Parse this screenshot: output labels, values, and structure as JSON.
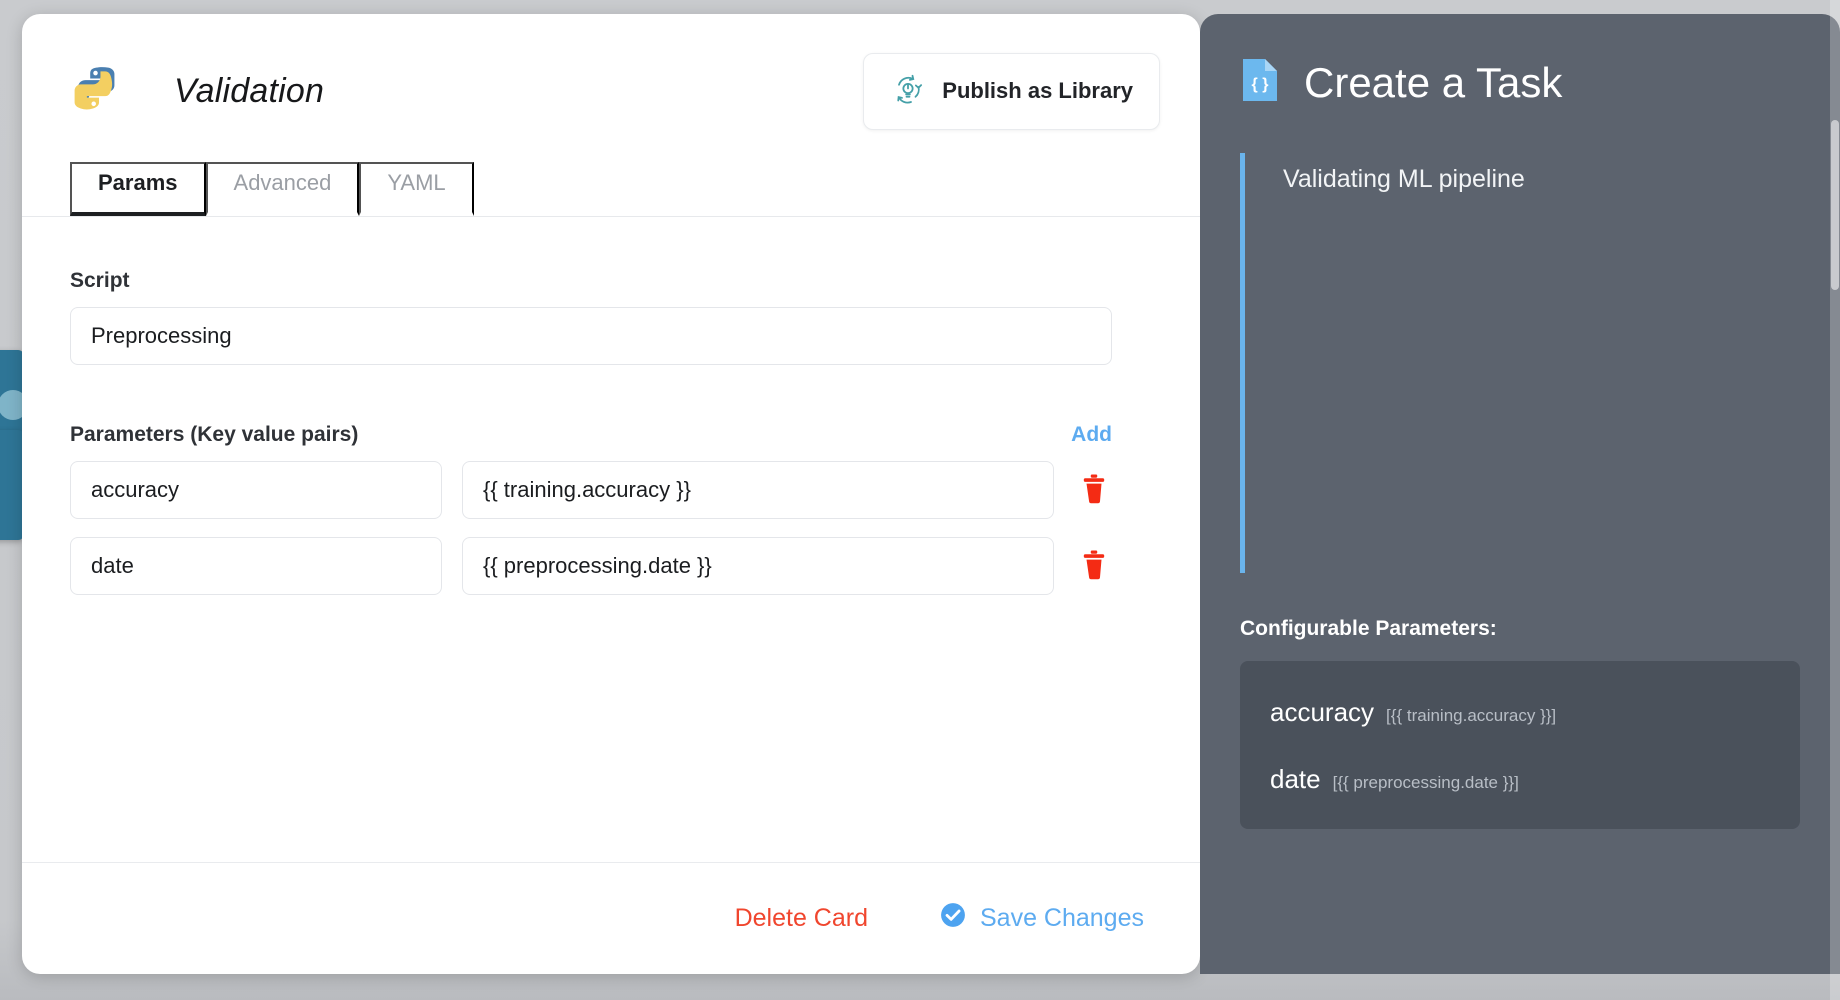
{
  "card": {
    "icon": "python-logo-icon",
    "title": "Validation",
    "publish": {
      "label": "Publish as Library",
      "icon": "recycle-lightbulb-icon"
    },
    "tabs": [
      {
        "label": "Params",
        "active": true
      },
      {
        "label": "Advanced",
        "active": false
      },
      {
        "label": "YAML",
        "active": false
      }
    ],
    "script": {
      "label": "Script",
      "value": "Preprocessing",
      "placeholder": "Script"
    },
    "parameters": {
      "label": "Parameters (Key value pairs)",
      "add_label": "Add",
      "key_placeholder": "Key",
      "value_placeholder": "Value",
      "delete_icon": "trash-icon",
      "rows": [
        {
          "key": "accuracy",
          "value": "{{ training.accuracy }}"
        },
        {
          "key": "date",
          "value": "{{ preprocessing.date }}"
        }
      ]
    },
    "footer": {
      "delete_label": "Delete Card",
      "save_label": "Save Changes",
      "save_icon": "check-circle-icon"
    }
  },
  "panel": {
    "icon": "json-document-icon",
    "title": "Create a Task",
    "quote": "Validating ML pipeline",
    "config_title": "Configurable Parameters:",
    "config_items": [
      {
        "key": "accuracy",
        "expr": "[{{ training.accuracy }}]"
      },
      {
        "key": "date",
        "expr": "[{{ preprocessing.date }}]"
      }
    ]
  },
  "colors": {
    "accent_blue": "#5dabf0",
    "danger_red": "#f0462e",
    "panel_bg": "#5c636e",
    "quote_border": "#6ab4ec",
    "teal": "#45a0a8"
  }
}
